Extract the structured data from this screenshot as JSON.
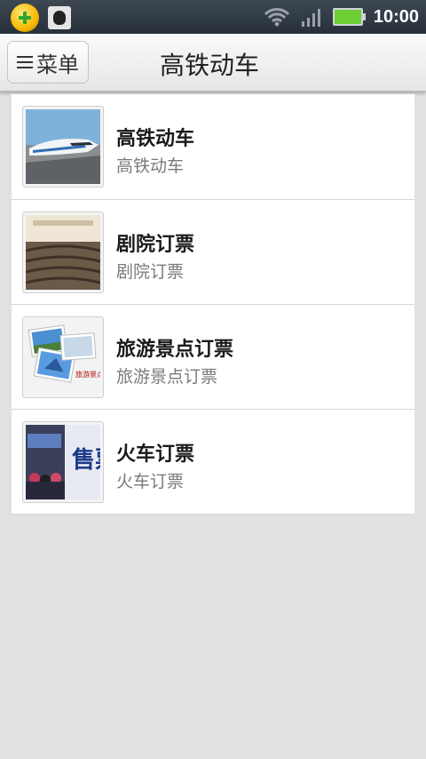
{
  "status_bar": {
    "time": "10:00",
    "left_icons": [
      "shield-360-icon",
      "bug-icon"
    ],
    "right_icons": [
      "wifi-icon",
      "signal-icon",
      "battery-icon"
    ],
    "battery_color": "#6ccf35"
  },
  "header": {
    "menu_label": "菜单",
    "title": "高铁动车"
  },
  "list": {
    "items": [
      {
        "title": "高铁动车",
        "subtitle": "高铁动车",
        "thumb": "bullet-train-photo"
      },
      {
        "title": "剧院订票",
        "subtitle": "剧院订票",
        "thumb": "theater-photo"
      },
      {
        "title": "旅游景点订票",
        "subtitle": "旅游景点订票",
        "thumb": "scenic-spots-photo",
        "thumb_caption": "旅游景点"
      },
      {
        "title": "火车订票",
        "subtitle": "火车订票",
        "thumb": "train-ticket-office-photo",
        "thumb_caption": "售票"
      }
    ]
  }
}
